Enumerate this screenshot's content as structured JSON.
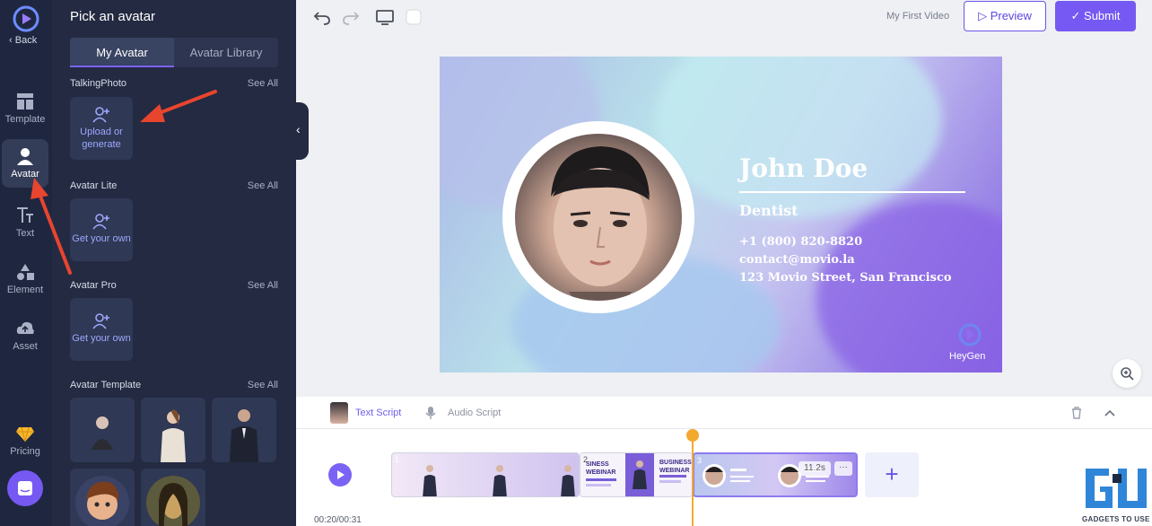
{
  "rail": {
    "back_label": "Back",
    "items": [
      {
        "label": "Template",
        "icon": "template-icon"
      },
      {
        "label": "Avatar",
        "icon": "avatar-icon"
      },
      {
        "label": "Text",
        "icon": "text-icon"
      },
      {
        "label": "Element",
        "icon": "element-icon"
      },
      {
        "label": "Asset",
        "icon": "asset-icon"
      },
      {
        "label": "Pricing",
        "icon": "pricing-icon"
      }
    ]
  },
  "panel": {
    "title": "Pick an avatar",
    "tabs": [
      "My Avatar",
      "Avatar Library"
    ],
    "see_all": "See All",
    "sections": [
      {
        "label": "TalkingPhoto",
        "tile_label": "Upload or generate"
      },
      {
        "label": "Avatar Lite",
        "tile_label": "Get your own"
      },
      {
        "label": "Avatar Pro",
        "tile_label": "Get your own"
      },
      {
        "label": "Avatar Template"
      }
    ]
  },
  "topbar": {
    "video_name": "My First Video",
    "preview_label": "Preview",
    "submit_label": "Submit"
  },
  "card": {
    "name": "John Doe",
    "role": "Dentist",
    "phone": "+1 (800) 820-8820",
    "email": "contact@movio.la",
    "address": "123 Movio Street, San Francisco",
    "brand": "HeyGen"
  },
  "script": {
    "text_tab": "Text Script",
    "audio_tab": "Audio Script"
  },
  "timeline": {
    "clips": [
      {
        "num": "1"
      },
      {
        "num": "2",
        "texts": [
          "SINESS WEBINAR",
          "BUSINESS WEBINAR"
        ]
      },
      {
        "num": "3"
      }
    ],
    "duration_badge": "11.2s",
    "more_label": "···",
    "add_label": "+",
    "time": "00:20/00:31"
  },
  "watermark": "GADGETS TO USE",
  "colors": {
    "accent": "#7559f2",
    "rail_bg": "#1f2740",
    "panel_bg": "#232a41",
    "playhead": "#f2a92e",
    "annotation": "#e8452f"
  }
}
